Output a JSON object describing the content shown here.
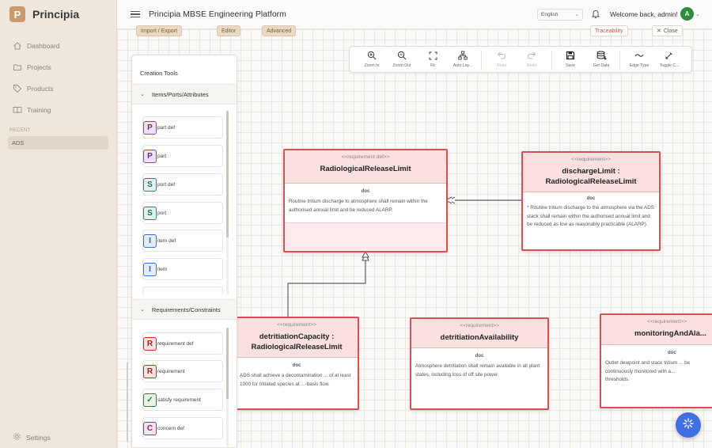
{
  "app": {
    "brand_letter": "P",
    "brand_name": "Principia",
    "title": "Principia MBSE Engineering Platform",
    "language": "English",
    "welcome": "Welcome back, admin!",
    "avatar_letter": "A"
  },
  "sidebar": {
    "items": [
      {
        "label": "Dashboard",
        "icon": "home-icon"
      },
      {
        "label": "Projects",
        "icon": "folder-icon"
      },
      {
        "label": "Products",
        "icon": "tag-icon"
      },
      {
        "label": "Training",
        "icon": "book-icon"
      }
    ],
    "recent_label": "RECENT",
    "recent": [
      "ADS"
    ],
    "settings": "Settings"
  },
  "subtoolbar": {
    "import_export": "Import / Export",
    "editor": "Editor",
    "advanced": "Advanced",
    "traceability": "Traceability",
    "close": "Close"
  },
  "tools": [
    {
      "label": "Zoom In",
      "icon": "zoom-in-icon"
    },
    {
      "label": "Zoom Out",
      "icon": "zoom-out-icon"
    },
    {
      "label": "Fit",
      "icon": "fit-icon"
    },
    {
      "label": "Auto Lay...",
      "icon": "auto-layout-icon"
    },
    {
      "label": "Undo",
      "icon": "undo-icon"
    },
    {
      "label": "Redo",
      "icon": "redo-icon"
    },
    {
      "label": "Save",
      "icon": "save-icon"
    },
    {
      "label": "Get Data",
      "icon": "database-icon"
    },
    {
      "label": "Edge Type",
      "icon": "edge-type-icon"
    },
    {
      "label": "Toggle C...",
      "icon": "toggle-icon"
    }
  ],
  "panel": {
    "title": "Creation Tools",
    "section1": "Items/Ports/Attributes",
    "section2": "Requirements/Constraints",
    "items1": [
      {
        "letter": "P",
        "label": "part def"
      },
      {
        "letter": "P",
        "label": "part"
      },
      {
        "letter": "S",
        "label": "port def"
      },
      {
        "letter": "S",
        "label": "port"
      },
      {
        "letter": "I",
        "label": "item def"
      },
      {
        "letter": "I",
        "label": "item"
      }
    ],
    "items2": [
      {
        "letter": "R",
        "label": "requirement def"
      },
      {
        "letter": "R",
        "label": "requirement"
      },
      {
        "letter": "✓",
        "label": "satisfy requirement"
      },
      {
        "letter": "C",
        "label": "concern def"
      }
    ]
  },
  "nodes": [
    {
      "stereotype": "<<requirement def>>",
      "name": "RadiologicalReleaseLimit",
      "doc_label": "doc",
      "doc": "Routine tritium discharge to atmosphere shall remain within the authorised annual limit and be reduced ALARP."
    },
    {
      "stereotype": "<<requirement>>",
      "name": "dischargeLimit : RadiologicalReleaseLimit",
      "doc_label": "doc",
      "doc": "* Routine tritium discharge to the atmosphere via the ADS stack shall remain within the authorised annual limit and be reduced as low as reasonably practicable (ALARP)."
    },
    {
      "stereotype": "<<requirement>>",
      "name": "detritiationCapacity : RadiologicalReleaseLimit",
      "doc_label": "doc",
      "doc": "ADS shall achieve a decontamination ... of at least 1000 for tritiated species at ...-basis flow."
    },
    {
      "stereotype": "<<requirement>>",
      "name": "detritiationAvailability",
      "doc_label": "doc",
      "doc": "Atmosphere detritiation shall remain available in all plant states, including loss of off site power."
    },
    {
      "stereotype": "<<requirement>>",
      "name": "monitoringAndAla...",
      "doc_label": "doc",
      "doc": "Outlet dewpoint and stack tritium ... be continuously monitored with a... thresholds."
    }
  ]
}
